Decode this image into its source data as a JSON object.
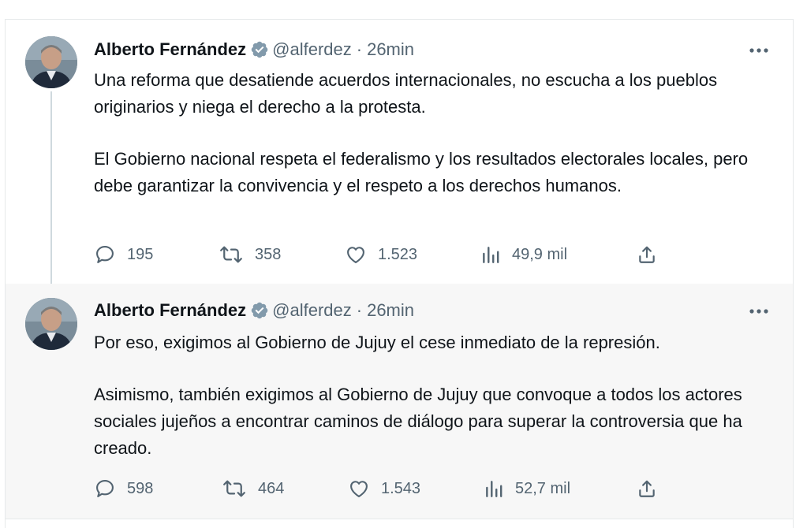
{
  "tweets": [
    {
      "author": {
        "name": "Alberto Fernández",
        "handle": "@alferdez",
        "verified": true
      },
      "separator": "·",
      "time": "26min",
      "paragraphs": [
        "Una reforma que desatiende acuerdos internacionales, no escucha a los pueblos originarios y niega el derecho a la protesta.",
        "El Gobierno nacional respeta el federalismo y los resultados electorales locales, pero debe garantizar la convivencia y el respeto a los derechos humanos."
      ],
      "stats": {
        "replies": "195",
        "retweets": "358",
        "likes": "1.523",
        "views": "49,9 mil"
      }
    },
    {
      "author": {
        "name": "Alberto Fernández",
        "handle": "@alferdez",
        "verified": true
      },
      "separator": "·",
      "time": "26min",
      "paragraphs": [
        "Por eso, exigimos al Gobierno de Jujuy el cese inmediato de la represión.",
        "Asimismo, también exigimos al Gobierno de Jujuy que convoque a todos los actores sociales jujeños a encontrar caminos de diálogo para superar la controversia que ha creado."
      ],
      "stats": {
        "replies": "598",
        "retweets": "464",
        "likes": "1.543",
        "views": "52,7 mil"
      }
    }
  ],
  "icons": {
    "verified": "verified-badge-icon",
    "more": "more-options-icon",
    "reply": "reply-icon",
    "retweet": "retweet-icon",
    "like": "like-icon",
    "views": "views-icon",
    "share": "share-icon"
  },
  "colors": {
    "verified_badge": "#829aab",
    "text": "#0f1419",
    "secondary": "#536471",
    "thread_line": "#cfd9de"
  }
}
